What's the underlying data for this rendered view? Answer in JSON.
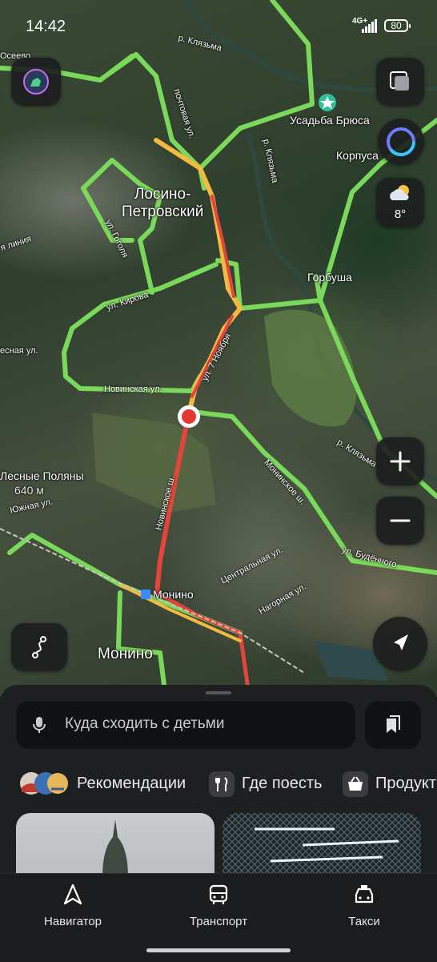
{
  "status_bar": {
    "time": "14:42",
    "network": "4G+",
    "battery": "80"
  },
  "map": {
    "labels": {
      "oseevo": "Осеево",
      "river_klyazma_1": "р. Клязьма",
      "river_klyazma_2": "р. Клязьма",
      "river_klyazma_3": "р. Клязьма",
      "pochtovaya": "почтовая ул.",
      "usadba": "Усадьба Брюса",
      "korpusa": "Корпуса",
      "city_losino": "Лосино-\nПетровский",
      "gogolya": "ул. Гоголя",
      "liniya": "я линия",
      "gorbusha": "Горбуша",
      "kirova": "ул. Кирова",
      "lesnaya": "есная ул.",
      "noyabrya": "ул. 7 Ноября",
      "novinskaya": "Новинская ул.",
      "novinskoe": "Новинское ш.",
      "monino_sh": "Монинское ш.",
      "lesnye_polyany": "Лесные Поляны",
      "scale": "640 м",
      "yuzhnaya": "Южная ул.",
      "tsentralnaya": "Центральная ул.",
      "nagornaya": "Нагорная ул.",
      "budennogo": "ул. Будённого",
      "station_monino": "Монино",
      "city_monino": "Монино"
    },
    "weather": {
      "temp": "8°"
    }
  },
  "sheet": {
    "search_placeholder": "Куда сходить с детьми",
    "chips": [
      "Рекомендации",
      "Где поесть",
      "Продукты"
    ]
  },
  "nav": {
    "items": [
      {
        "label": "Навигатор",
        "icon": "navigator-arrow-icon"
      },
      {
        "label": "Транспорт",
        "icon": "bus-icon"
      },
      {
        "label": "Такси",
        "icon": "taxi-icon"
      }
    ]
  },
  "colors": {
    "traffic_free": "#7ad85a",
    "traffic_slow": "#f5b942",
    "traffic_jam": "#e2453c",
    "accent": "#3b8cff"
  }
}
